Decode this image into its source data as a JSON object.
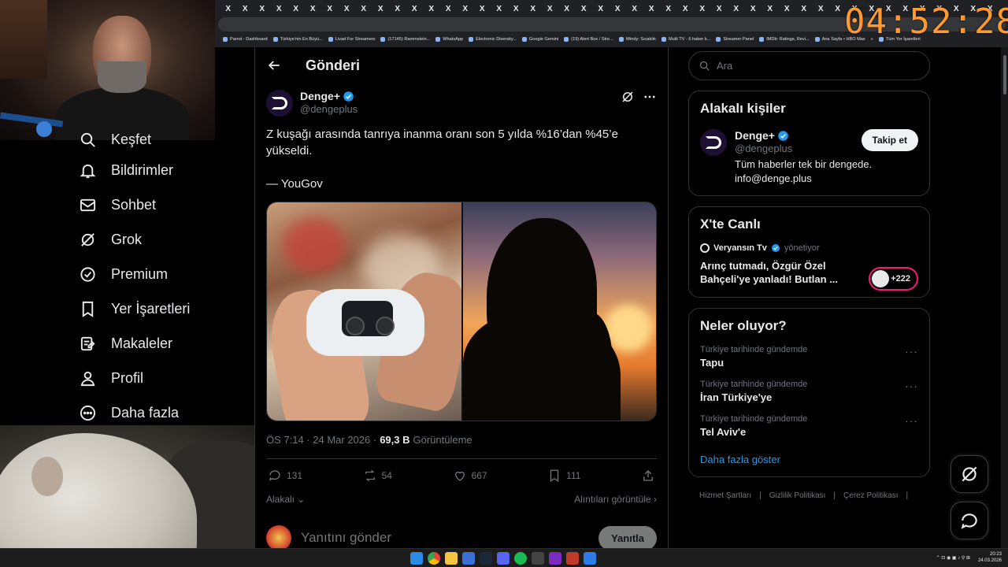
{
  "overlay": {
    "clock": "04:52:28"
  },
  "browser": {
    "tab_count": 46,
    "tab_glyph": "X",
    "bookmarks": [
      "Parrot - Dashboard",
      "Türkiye'nin En Büyü...",
      "Livad For Streamers",
      "(17145) Rammstein...",
      "WhatsApp",
      "Electronic Diversity...",
      "Google Gemini",
      "(19) Alert Box / Stre...",
      "Windy: Sıcaklık",
      "Multi TV - 6 haber k...",
      "Streamer Panel",
      "IMDb: Ratings, Revi...",
      "Ana Sayfa • HBO Max",
      "»",
      "Tüm Yer İşaretleri"
    ]
  },
  "nav": {
    "items": [
      {
        "label": "Keşfet",
        "icon": "search-icon"
      },
      {
        "label": "Bildirimler",
        "icon": "bell-icon"
      },
      {
        "label": "Sohbet",
        "icon": "mail-icon"
      },
      {
        "label": "Grok",
        "icon": "grok-icon"
      },
      {
        "label": "Premium",
        "icon": "verified-badge-icon"
      },
      {
        "label": "Yer İşaretleri",
        "icon": "bookmark-icon"
      },
      {
        "label": "Makaleler",
        "icon": "article-icon"
      },
      {
        "label": "Profil",
        "icon": "person-icon"
      },
      {
        "label": "Daha fazla",
        "icon": "more-circle-icon"
      }
    ]
  },
  "post": {
    "header_title": "Gönderi",
    "author_name": "Denge+",
    "author_handle": "@dengeplus",
    "text": "Z kuşağı arasında tanrıya inanma oranı son 5 yılda %16’dan %45’e yükseldi.\n\n— YouGov",
    "time": "ÖS 7:14 · 24 Mar 2026 ·",
    "views": "69,3 B",
    "views_label": "Görüntüleme",
    "stats": {
      "replies": "131",
      "reposts": "54",
      "likes": "667",
      "bookmarks": "111"
    },
    "related_label": "Alakalı",
    "quotes_label": "Alıntıları görüntüle",
    "reply_placeholder": "Yanıtını gönder",
    "reply_button": "Yanıtla"
  },
  "sidebar": {
    "search_placeholder": "Ara",
    "related_title": "Alakalı kişiler",
    "person": {
      "name": "Denge+",
      "handle": "@dengeplus",
      "follow": "Takip et",
      "bio_line1": "Tüm haberler tek bir dengede.",
      "bio_line2": "info@denge.plus"
    },
    "live": {
      "title": "X'te Canlı",
      "host": "Veryansın Tv",
      "role": "yönetiyor",
      "headline": "Arınç tutmadı, Özgür Özel Bahçeli'ye yanladı! Butlan ...",
      "listeners": "+222"
    },
    "trends_title": "Neler oluyor?",
    "trends": [
      {
        "context": "Türkiye tarihinde gündemde",
        "name": "Tapu"
      },
      {
        "context": "Türkiye tarihinde gündemde",
        "name": "İran Türkiye'ye"
      },
      {
        "context": "Türkiye tarihinde gündemde",
        "name": "Tel Aviv'e"
      }
    ],
    "show_more": "Daha fazla göster",
    "footer": [
      "Hizmet Şartları",
      "|",
      "Gizlilik Politikası",
      "|",
      "Çerez Politikası",
      "|"
    ]
  },
  "taskbar": {
    "time": "20:23",
    "date": "24.03.2026"
  },
  "colors": {
    "accent": "#1d9bf0",
    "live": "#f91880",
    "clock": "#ff9a2e"
  }
}
